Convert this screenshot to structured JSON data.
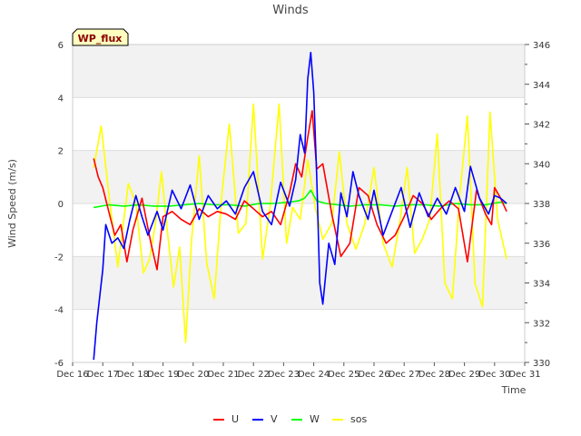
{
  "chart_data": {
    "type": "line",
    "title": "Winds",
    "xlabel": "Time",
    "ylabel": "Wind Speed (m/s)",
    "y2label": "",
    "badge": "WP_flux",
    "x_tick_labels": [
      "Dec 16",
      "Dec 17",
      "Dec 18",
      "Dec 19",
      "Dec 20",
      "Dec 21",
      "Dec 22",
      "Dec 23",
      "Dec 24",
      "Dec 25",
      "Dec 26",
      "Dec 27",
      "Dec 28",
      "Dec 29",
      "Dec 30",
      "Dec 31"
    ],
    "x_domain_days": [
      16,
      31
    ],
    "ylim": [
      -6,
      6
    ],
    "y_ticks": [
      -6,
      -4,
      -2,
      0,
      2,
      4,
      6
    ],
    "y2lim": [
      330,
      346
    ],
    "y2_ticks": [
      330,
      332,
      334,
      336,
      338,
      340,
      342,
      344,
      346
    ],
    "grid": true,
    "legend_position": "bottom",
    "series": [
      {
        "name": "U",
        "axis": "left",
        "color": "#ff0000",
        "x": [
          16.7,
          16.85,
          17.0,
          17.2,
          17.4,
          17.6,
          17.8,
          18.0,
          18.3,
          18.6,
          18.8,
          19.0,
          19.3,
          19.6,
          19.9,
          20.2,
          20.5,
          20.8,
          21.1,
          21.4,
          21.7,
          22.0,
          22.3,
          22.6,
          22.9,
          23.2,
          23.4,
          23.6,
          23.8,
          23.95,
          24.1,
          24.3,
          24.6,
          24.9,
          25.2,
          25.5,
          25.8,
          26.1,
          26.4,
          26.7,
          27.0,
          27.3,
          27.6,
          27.9,
          28.2,
          28.5,
          28.8,
          29.1,
          29.4,
          29.7,
          29.9,
          30.0,
          30.2,
          30.4
        ],
        "y": [
          1.7,
          1.0,
          0.6,
          -0.3,
          -1.2,
          -0.8,
          -2.2,
          -1.0,
          0.2,
          -1.5,
          -2.5,
          -0.5,
          -0.3,
          -0.6,
          -0.8,
          -0.2,
          -0.5,
          -0.3,
          -0.4,
          -0.6,
          0.1,
          -0.2,
          -0.5,
          -0.3,
          -0.8,
          0.4,
          1.5,
          1.0,
          2.5,
          3.5,
          1.3,
          1.5,
          -0.4,
          -2.0,
          -1.5,
          0.6,
          0.3,
          -0.8,
          -1.5,
          -1.2,
          -0.5,
          0.3,
          0.0,
          -0.6,
          -0.2,
          0.1,
          -0.2,
          -2.2,
          0.5,
          -0.4,
          -0.8,
          0.6,
          0.2,
          -0.3
        ]
      },
      {
        "name": "V",
        "axis": "left",
        "color": "#0000ff",
        "x": [
          16.7,
          16.8,
          16.9,
          17.0,
          17.1,
          17.3,
          17.5,
          17.7,
          17.9,
          18.1,
          18.3,
          18.5,
          18.8,
          19.0,
          19.3,
          19.6,
          19.9,
          20.2,
          20.5,
          20.8,
          21.1,
          21.4,
          21.7,
          22.0,
          22.3,
          22.6,
          22.9,
          23.2,
          23.4,
          23.55,
          23.7,
          23.8,
          23.9,
          24.0,
          24.1,
          24.2,
          24.3,
          24.5,
          24.7,
          24.9,
          25.1,
          25.3,
          25.5,
          25.8,
          26.0,
          26.3,
          26.6,
          26.9,
          27.2,
          27.5,
          27.8,
          28.1,
          28.4,
          28.7,
          29.0,
          29.2,
          29.5,
          29.8,
          30.0,
          30.2,
          30.4
        ],
        "y": [
          -5.9,
          -4.5,
          -3.5,
          -2.5,
          -0.8,
          -1.5,
          -1.3,
          -1.7,
          -0.6,
          0.3,
          -0.5,
          -1.2,
          -0.3,
          -1.0,
          0.5,
          -0.2,
          0.7,
          -0.6,
          0.3,
          -0.2,
          0.1,
          -0.4,
          0.6,
          1.2,
          -0.3,
          -0.8,
          0.8,
          -0.1,
          0.9,
          2.6,
          1.9,
          4.7,
          5.7,
          4.2,
          1.0,
          -3.0,
          -3.8,
          -1.5,
          -2.3,
          0.4,
          -0.5,
          1.2,
          0.3,
          -0.6,
          0.5,
          -1.2,
          -0.3,
          0.6,
          -0.9,
          0.4,
          -0.5,
          0.2,
          -0.4,
          0.6,
          -0.3,
          1.4,
          0.2,
          -0.4,
          0.3,
          0.2,
          0.0
        ]
      },
      {
        "name": "W",
        "axis": "left",
        "color": "#00ff00",
        "x": [
          16.7,
          17.2,
          17.7,
          18.2,
          18.7,
          19.2,
          19.7,
          20.2,
          20.7,
          21.2,
          21.7,
          22.2,
          22.7,
          23.2,
          23.5,
          23.7,
          23.9,
          24.1,
          24.4,
          24.8,
          25.2,
          25.7,
          26.2,
          26.7,
          27.2,
          27.7,
          28.2,
          28.7,
          29.2,
          29.7,
          30.2,
          30.4
        ],
        "y": [
          -0.15,
          -0.05,
          -0.1,
          -0.05,
          -0.1,
          -0.1,
          -0.05,
          0.0,
          -0.05,
          -0.05,
          -0.1,
          0.0,
          0.0,
          0.05,
          0.1,
          0.2,
          0.5,
          0.1,
          0.0,
          -0.05,
          -0.1,
          -0.05,
          -0.05,
          -0.1,
          -0.05,
          -0.05,
          -0.1,
          0.0,
          -0.05,
          -0.05,
          0.05,
          0.0
        ]
      },
      {
        "name": "sos",
        "axis": "right",
        "color": "#ffff00",
        "x": [
          16.7,
          16.95,
          17.2,
          17.5,
          17.85,
          18.1,
          18.35,
          18.55,
          18.75,
          18.95,
          19.15,
          19.35,
          19.55,
          19.75,
          19.95,
          20.2,
          20.45,
          20.7,
          20.95,
          21.2,
          21.5,
          21.75,
          22.0,
          22.3,
          22.55,
          22.85,
          23.1,
          23.3,
          23.55,
          23.8,
          24.05,
          24.3,
          24.6,
          24.85,
          25.1,
          25.4,
          25.7,
          26.0,
          26.3,
          26.6,
          26.85,
          27.1,
          27.35,
          27.6,
          27.85,
          28.1,
          28.35,
          28.6,
          28.85,
          29.1,
          29.35,
          29.6,
          29.85,
          30.1,
          30.4
        ],
        "y": [
          339.8,
          341.9,
          338.5,
          334.8,
          339.0,
          338.0,
          334.5,
          335.2,
          337.0,
          339.6,
          336.5,
          333.8,
          335.8,
          331.0,
          336.2,
          340.4,
          335.0,
          333.2,
          338.4,
          342.0,
          336.5,
          337.0,
          343.0,
          335.2,
          337.8,
          343.0,
          336.0,
          337.8,
          337.2,
          340.2,
          337.8,
          336.2,
          337.0,
          340.6,
          337.0,
          335.7,
          337.0,
          339.8,
          336.0,
          334.8,
          337.0,
          339.8,
          335.5,
          336.2,
          337.2,
          341.5,
          334.0,
          333.2,
          338.5,
          342.4,
          334.0,
          332.8,
          342.6,
          337.2,
          335.2
        ]
      }
    ]
  }
}
